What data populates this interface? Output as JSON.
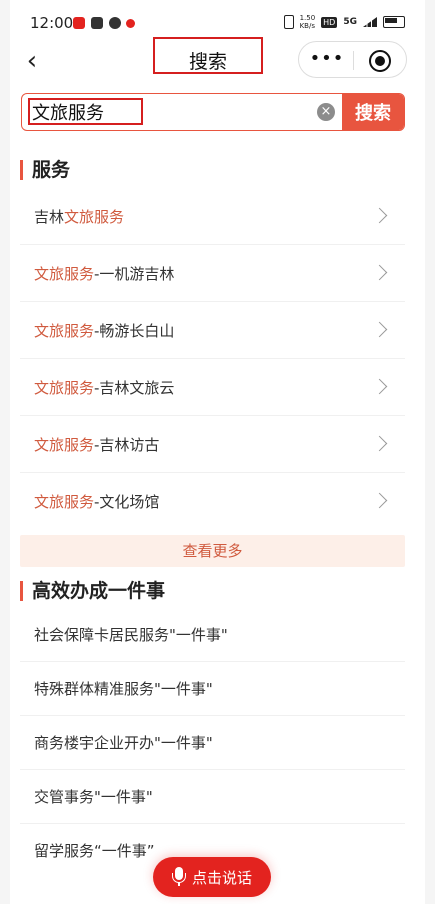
{
  "status": {
    "time": "12:00",
    "speed": "1.50\nKB/s",
    "hd": "HD",
    "network": "5G"
  },
  "nav": {
    "back_glyph": "‹",
    "title": "搜索",
    "more_glyph": "•••"
  },
  "search": {
    "value": "文旅服务",
    "placeholder": "",
    "button": "搜索",
    "clear_glyph": "×"
  },
  "services": {
    "title": "服务",
    "items": [
      {
        "pre": "吉林",
        "hl": "文旅服务",
        "post": ""
      },
      {
        "pre": "",
        "hl": "文旅服务",
        "post": "-一机游吉林"
      },
      {
        "pre": "",
        "hl": "文旅服务",
        "post": "-畅游长白山"
      },
      {
        "pre": "",
        "hl": "文旅服务",
        "post": "-吉林文旅云"
      },
      {
        "pre": "",
        "hl": "文旅服务",
        "post": "-吉林访古"
      },
      {
        "pre": "",
        "hl": "文旅服务",
        "post": "-文化场馆"
      }
    ],
    "more": "查看更多"
  },
  "matters": {
    "title": "高效办成一件事",
    "items": [
      "社会保障卡居民服务\"一件事\"",
      "特殊群体精准服务\"一件事\"",
      "商务楼宇企业开办\"一件事\"",
      "交管事务\"一件事\"",
      "留学服务“一件事”"
    ]
  },
  "voice": {
    "label": "点击说话"
  },
  "colors": {
    "accent": "#e8553f",
    "highlight": "#d05a3e",
    "voice": "#e3231f",
    "annotation": "#d51f1f"
  }
}
